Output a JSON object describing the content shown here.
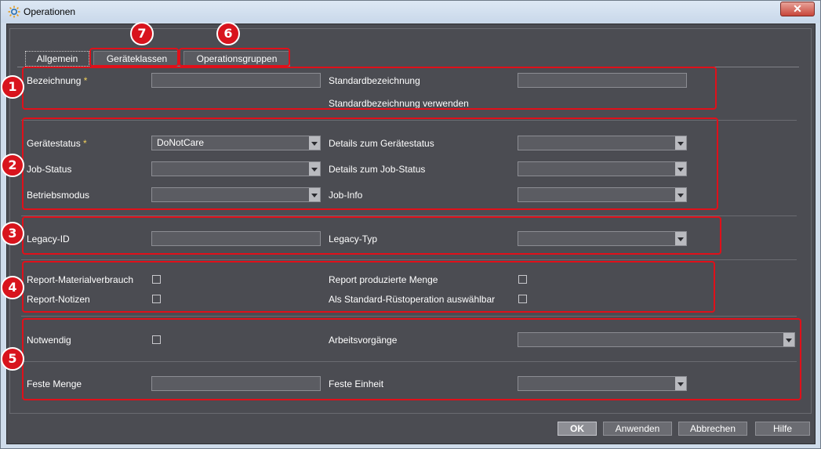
{
  "window": {
    "title": "Operationen",
    "close_label": "✕"
  },
  "tabs": [
    {
      "label": "Allgemein"
    },
    {
      "label": "Geräteklassen"
    },
    {
      "label": "Operationsgruppen"
    }
  ],
  "general": {
    "bezeichnung_label": "Bezeichnung",
    "required_mark": "*",
    "standardbezeichnung_label": "Standardbezeichnung",
    "standardbezeichnung_verwenden_label": "Standardbezeichnung verwenden"
  },
  "status": {
    "geraetestatus_label": "Gerätestatus",
    "geraetestatus_value": "DoNotCare",
    "details_geraetestatus_label": "Details zum Gerätestatus",
    "job_status_label": "Job-Status",
    "details_job_status_label": "Details zum Job-Status",
    "betriebsmodus_label": "Betriebsmodus",
    "job_info_label": "Job-Info"
  },
  "legacy": {
    "legacy_id_label": "Legacy-ID",
    "legacy_typ_label": "Legacy-Typ"
  },
  "reports": {
    "report_materialverbrauch_label": "Report-Materialverbrauch",
    "report_produzierte_menge_label": "Report produzierte Menge",
    "report_notizen_label": "Report-Notizen",
    "als_standard_label": "Als Standard-Rüstoperation auswählbar"
  },
  "misc": {
    "notwendig_label": "Notwendig",
    "arbeitsvorgaenge_label": "Arbeitsvorgänge",
    "feste_menge_label": "Feste Menge",
    "feste_einheit_label": "Feste Einheit"
  },
  "buttons": {
    "ok": "OK",
    "anwenden": "Anwenden",
    "abbrechen": "Abbrechen",
    "hilfe": "Hilfe"
  },
  "annotations": [
    "1",
    "2",
    "3",
    "4",
    "5",
    "6",
    "7"
  ],
  "colors": {
    "annotation_red": "#e0101a",
    "panel_bg": "#4b4c52",
    "required_star": "#f2d15b"
  }
}
